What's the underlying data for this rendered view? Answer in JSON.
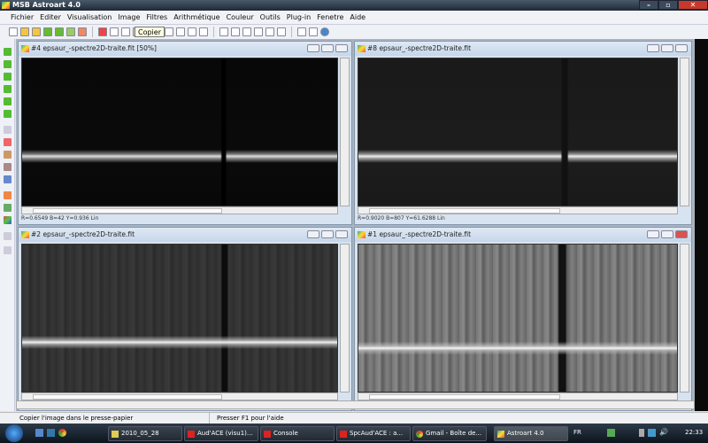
{
  "window": {
    "title": "MSB Astroart 4.0"
  },
  "menu": [
    "Fichier",
    "Editer",
    "Visualisation",
    "Image",
    "Filtres",
    "Arithmétique",
    "Couleur",
    "Outils",
    "Plug-in",
    "Fenetre",
    "Aide"
  ],
  "tooltip": "Copier",
  "panes": [
    {
      "title": "#4 epsaur_-spectre2D-traite.fit  [50%]",
      "status": "R=0.6549  B=42  Y=0.936 Lin"
    },
    {
      "title": "#8 epsaur_-spectre2D-traite.fit",
      "status": "R=0.9020  B=807  Y=61.6288 Lin"
    },
    {
      "title": "#2 epsaur_-spectre2D-traite.fit",
      "status": ""
    },
    {
      "title": "#1 epsaur_-spectre2D-traite.fit",
      "status": ""
    }
  ],
  "statusbar": {
    "left": "Copier l'image dans le presse-papier",
    "right": "Presser F1 pour l'aide"
  },
  "taskbar": {
    "tasks": [
      "2010_05_28",
      "Aud'ACE (visu1)...",
      "Console",
      "SpcAud'ACE : a...",
      "Gmail - Boîte de...",
      "Astroart 4.0"
    ],
    "lang": "FR",
    "clock": "22:33"
  }
}
